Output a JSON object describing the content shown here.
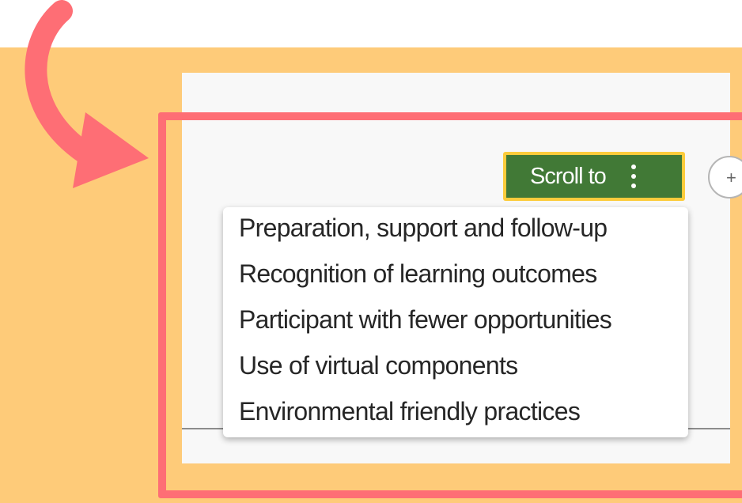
{
  "toolbar": {
    "scroll_to_label": "Scroll to"
  },
  "icons": {
    "kebab": "kebab-menu-icon",
    "arrow": "curved-arrow-icon",
    "side_button": "circle-button-icon"
  },
  "dropdown": {
    "items": [
      {
        "label": "Preparation, support and follow-up"
      },
      {
        "label": "Recognition of learning outcomes"
      },
      {
        "label": "Participant with fewer opportunities"
      },
      {
        "label": "Use of virtual components"
      },
      {
        "label": "Environmental friendly practices"
      }
    ]
  },
  "colors": {
    "background": "#fecb79",
    "highlight": "#fe6e75",
    "button_fill": "#417936",
    "button_border": "#fccc3c",
    "panel": "#f8f8f8"
  }
}
